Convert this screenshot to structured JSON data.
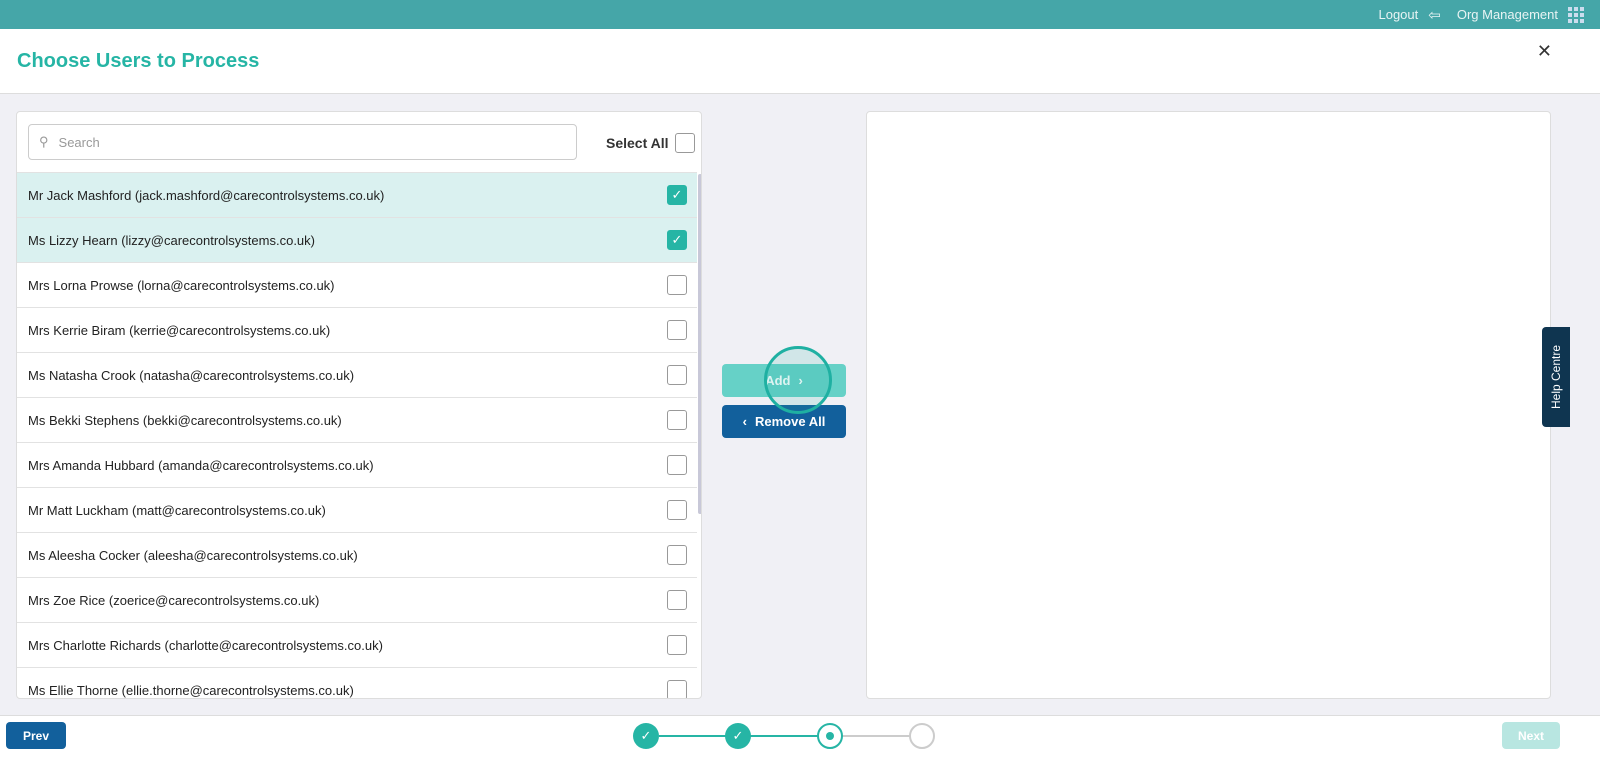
{
  "topbar": {
    "logout": "Logout",
    "org": "Org Management"
  },
  "header": {
    "title": "Choose Users to Process"
  },
  "search": {
    "placeholder": "Search",
    "select_all": "Select All"
  },
  "users": [
    {
      "label": "Mr Jack Mashford (jack.mashford@carecontrolsystems.co.uk)",
      "checked": true
    },
    {
      "label": "Ms Lizzy Hearn (lizzy@carecontrolsystems.co.uk)",
      "checked": true
    },
    {
      "label": "Mrs Lorna Prowse (lorna@carecontrolsystems.co.uk)",
      "checked": false
    },
    {
      "label": "Mrs Kerrie Biram (kerrie@carecontrolsystems.co.uk)",
      "checked": false
    },
    {
      "label": "Ms Natasha Crook (natasha@carecontrolsystems.co.uk)",
      "checked": false
    },
    {
      "label": "Ms Bekki Stephens (bekki@carecontrolsystems.co.uk)",
      "checked": false
    },
    {
      "label": "Mrs Amanda Hubbard (amanda@carecontrolsystems.co.uk)",
      "checked": false
    },
    {
      "label": "Mr Matt Luckham (matt@carecontrolsystems.co.uk)",
      "checked": false
    },
    {
      "label": "Ms Aleesha Cocker (aleesha@carecontrolsystems.co.uk)",
      "checked": false
    },
    {
      "label": "Mrs Zoe Rice (zoerice@carecontrolsystems.co.uk)",
      "checked": false
    },
    {
      "label": "Mrs Charlotte Richards (charlotte@carecontrolsystems.co.uk)",
      "checked": false
    },
    {
      "label": "Ms Ellie Thorne (ellie.thorne@carecontrolsystems.co.uk)",
      "checked": false
    }
  ],
  "actions": {
    "add": "Add",
    "remove_all": "Remove All"
  },
  "help": "Help Centre",
  "footer": {
    "prev": "Prev",
    "next": "Next",
    "current_step": 3,
    "total_steps": 4
  },
  "colors": {
    "accent": "#26b5a5",
    "primary": "#12609c",
    "topbar": "#45a6a8"
  }
}
